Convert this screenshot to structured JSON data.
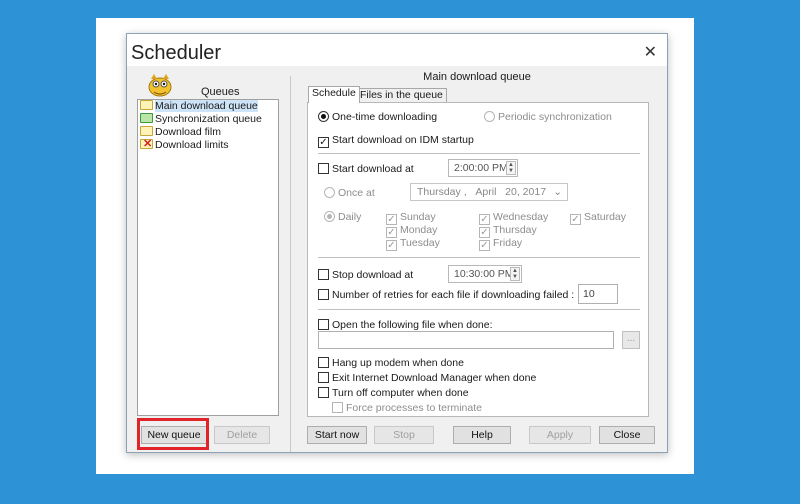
{
  "window": {
    "title": "Scheduler",
    "close_glyph": "✕"
  },
  "left": {
    "header": "Queues",
    "queues": [
      {
        "label": "Main download queue",
        "icon": "folder-icon",
        "selected": true
      },
      {
        "label": "Synchronization queue",
        "icon": "sync-folder-icon"
      },
      {
        "label": "Download film",
        "icon": "folder-icon"
      },
      {
        "label": "Download limits",
        "icon": "limits-icon"
      }
    ],
    "new_queue": "New queue",
    "delete": "Delete"
  },
  "main": {
    "queue_title": "Main download queue",
    "tabs": [
      "Schedule",
      "Files in the queue"
    ],
    "one_time": "One-time downloading",
    "periodic": "Periodic synchronization",
    "start_on_startup": "Start download on IDM startup",
    "start_at": "Start download at",
    "start_time": "2:00:00 PM",
    "once_at": "Once at",
    "date": {
      "day": "Thursday",
      "sep": ",",
      "month": "April",
      "date": "20, 2017"
    },
    "daily": "Daily",
    "days": {
      "sunday": "Sunday",
      "monday": "Monday",
      "tuesday": "Tuesday",
      "wednesday": "Wednesday",
      "thursday": "Thursday",
      "friday": "Friday",
      "saturday": "Saturday"
    },
    "stop_at": "Stop download at",
    "stop_time": "10:30:00 PM",
    "retries_label": "Number of retries for each file if downloading failed :",
    "retries_value": "10",
    "open_file": "Open the following file when done:",
    "browse": "...",
    "hang_up": "Hang up modem when done",
    "exit_idm": "Exit Internet Download Manager when done",
    "turn_off": "Turn off computer when done",
    "force": "Force processes to terminate"
  },
  "buttons": {
    "start_now": "Start now",
    "stop": "Stop",
    "help": "Help",
    "apply": "Apply",
    "close": "Close"
  },
  "colors": {
    "background": "#2d93d6",
    "highlight": "#e0242a"
  }
}
